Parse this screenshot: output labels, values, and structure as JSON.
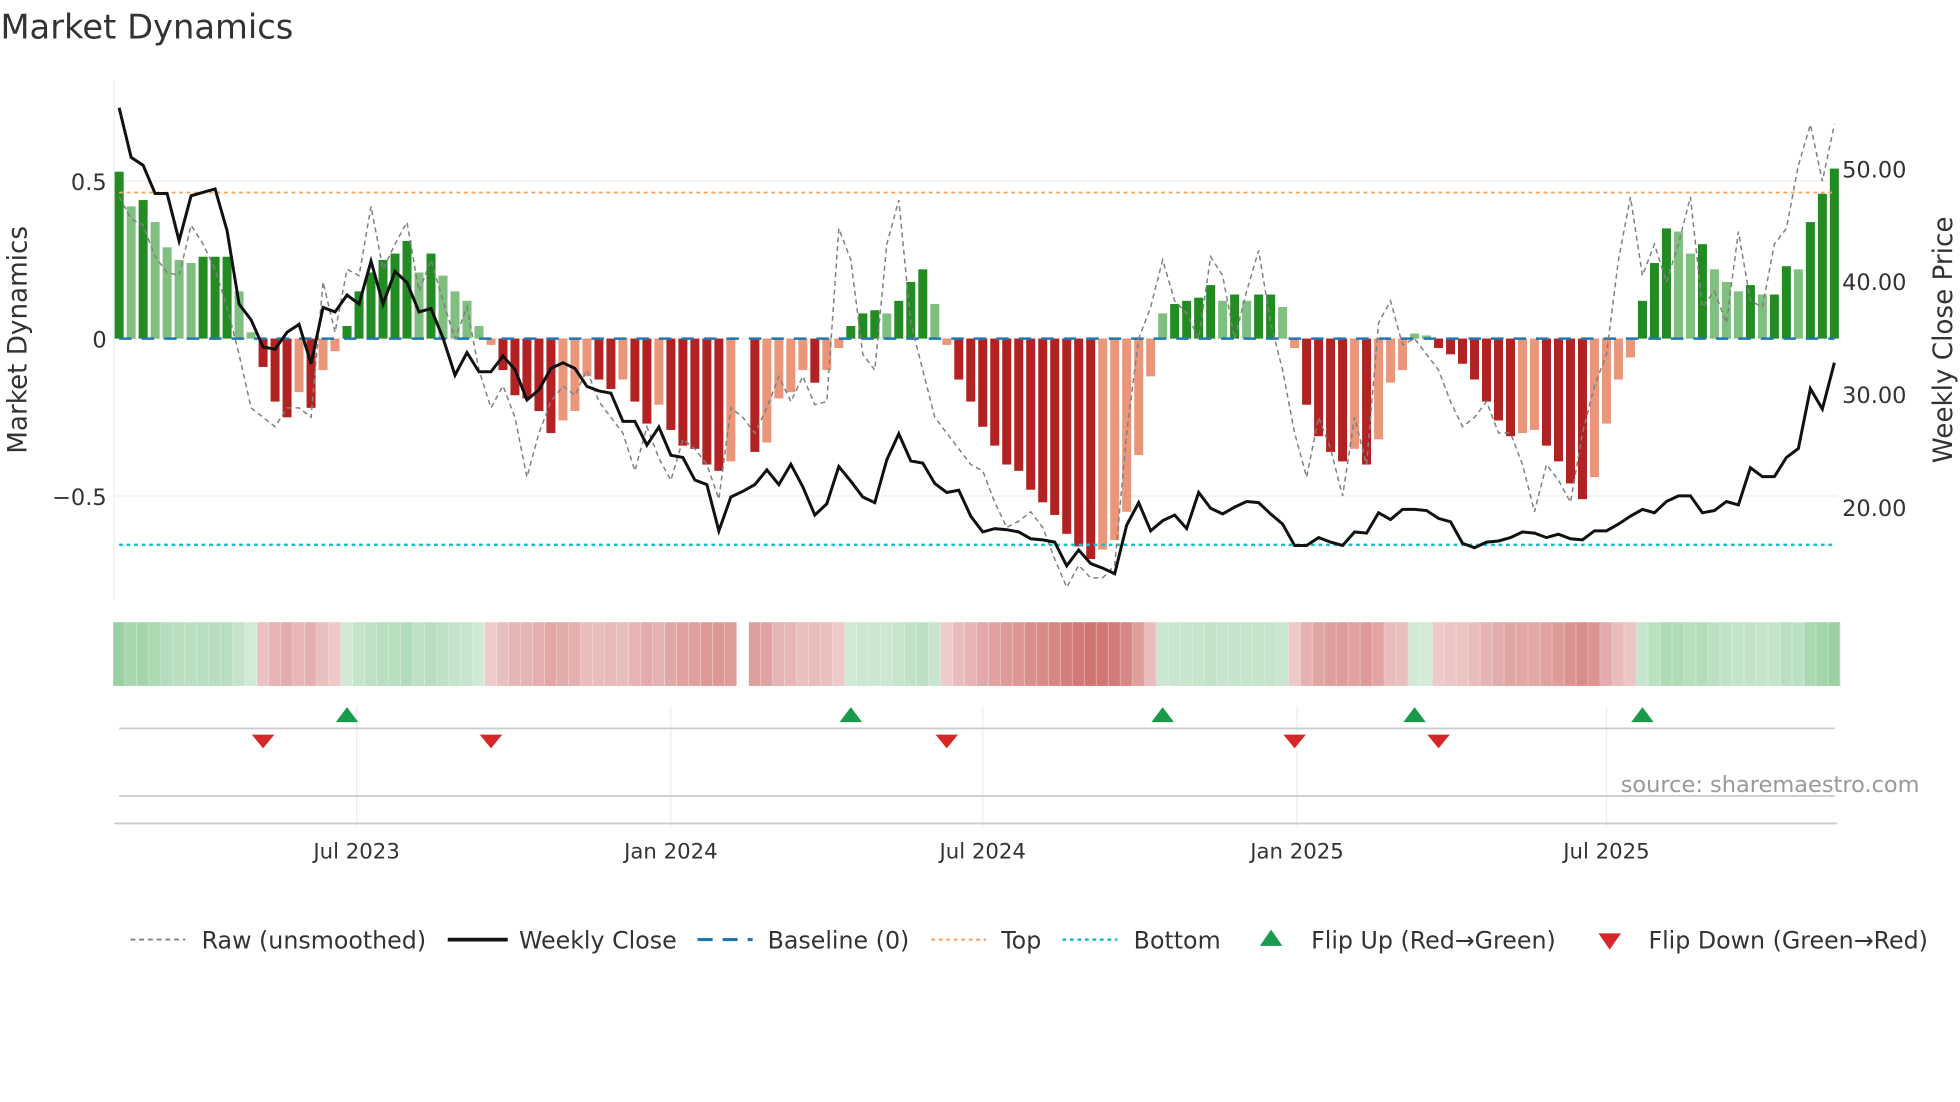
{
  "chart_data": {
    "type": "bar",
    "title": "Market Dynamics",
    "ylabel_left": "Market Dynamics",
    "ylabel_right": "Weekly Close Price",
    "ylim_left": [
      -0.83,
      0.78
    ],
    "ylim_right": [
      10.5,
      57
    ],
    "left_ticks": [
      {
        "v": 0.5,
        "label": "0.5"
      },
      {
        "v": 0,
        "label": "0"
      },
      {
        "v": -0.5,
        "label": "−0.5"
      }
    ],
    "right_ticks": [
      {
        "v": 50,
        "label": "50.00"
      },
      {
        "v": 40,
        "label": "40.00"
      },
      {
        "v": 30,
        "label": "30.00"
      },
      {
        "v": 20,
        "label": "20.00"
      }
    ],
    "x_ticks": [
      {
        "week": 19.8,
        "label": "Jul 2023"
      },
      {
        "week": 46.0,
        "label": "Jan 2024"
      },
      {
        "week": 72.0,
        "label": "Jul 2024"
      },
      {
        "week": 98.2,
        "label": "Jan 2025"
      },
      {
        "week": 124.0,
        "label": "Jul 2025"
      }
    ],
    "top_level": 0.464,
    "bottom_level": -0.655,
    "baseline": 0,
    "momentum": [
      0.53,
      0.42,
      0.44,
      0.37,
      0.29,
      0.25,
      0.24,
      0.26,
      0.26,
      0.26,
      0.15,
      0.02,
      -0.09,
      -0.2,
      -0.25,
      -0.17,
      -0.22,
      -0.1,
      -0.04,
      0.04,
      0.15,
      0.21,
      0.25,
      0.27,
      0.31,
      0.21,
      0.27,
      0.2,
      0.15,
      0.12,
      0.04,
      -0.02,
      -0.1,
      -0.18,
      -0.19,
      -0.23,
      -0.3,
      -0.26,
      -0.23,
      -0.12,
      -0.13,
      -0.16,
      -0.13,
      -0.2,
      -0.27,
      -0.21,
      -0.29,
      -0.34,
      -0.35,
      -0.4,
      -0.42,
      -0.39,
      null,
      -0.36,
      -0.33,
      -0.19,
      -0.17,
      -0.1,
      -0.14,
      -0.1,
      -0.03,
      0.04,
      0.08,
      0.09,
      0.08,
      0.12,
      0.18,
      0.22,
      0.11,
      -0.02,
      -0.13,
      -0.2,
      -0.28,
      -0.34,
      -0.4,
      -0.42,
      -0.48,
      -0.52,
      -0.56,
      -0.62,
      -0.66,
      -0.7,
      -0.67,
      -0.64,
      -0.55,
      -0.37,
      -0.12,
      0.08,
      0.11,
      0.12,
      0.13,
      0.17,
      0.12,
      0.14,
      0.12,
      0.14,
      0.14,
      0.1,
      -0.03,
      -0.21,
      -0.31,
      -0.36,
      -0.39,
      -0.35,
      -0.4,
      -0.32,
      -0.14,
      -0.1,
      0.016,
      0.01,
      -0.03,
      -0.05,
      -0.08,
      -0.13,
      -0.2,
      -0.26,
      -0.31,
      -0.3,
      -0.29,
      -0.34,
      -0.39,
      -0.46,
      -0.51,
      -0.44,
      -0.27,
      -0.13,
      -0.06,
      0.12,
      0.24,
      0.35,
      0.34,
      0.27,
      0.3,
      0.22,
      0.18,
      0.15,
      0.17,
      0.14,
      0.14,
      0.23,
      0.22,
      0.37,
      0.46,
      0.54
    ],
    "raw": [
      0.45,
      0.38,
      0.36,
      0.26,
      0.21,
      0.2,
      0.36,
      0.3,
      0.22,
      0.1,
      -0.05,
      -0.22,
      -0.25,
      -0.28,
      -0.22,
      -0.22,
      -0.25,
      0.18,
      0.02,
      0.22,
      0.2,
      0.42,
      0.22,
      0.3,
      0.37,
      0.15,
      0.25,
      0.12,
      0.0,
      0.1,
      -0.1,
      -0.22,
      -0.15,
      -0.25,
      -0.44,
      -0.3,
      -0.2,
      -0.15,
      -0.18,
      -0.1,
      -0.2,
      -0.25,
      -0.3,
      -0.42,
      -0.28,
      -0.38,
      -0.45,
      -0.32,
      -0.35,
      -0.4,
      -0.51,
      -0.22,
      -0.25,
      -0.3,
      -0.22,
      -0.12,
      -0.2,
      -0.12,
      -0.21,
      -0.2,
      0.35,
      0.25,
      -0.05,
      -0.1,
      0.3,
      0.44,
      0.05,
      -0.1,
      -0.25,
      -0.3,
      -0.35,
      -0.4,
      -0.42,
      -0.52,
      -0.6,
      -0.58,
      -0.55,
      -0.6,
      -0.7,
      -0.79,
      -0.72,
      -0.76,
      -0.76,
      -0.72,
      -0.3,
      0.0,
      0.1,
      0.25,
      0.12,
      0.08,
      0.0,
      0.26,
      0.2,
      0.0,
      0.15,
      0.28,
      0.05,
      -0.1,
      -0.3,
      -0.44,
      -0.25,
      -0.35,
      -0.5,
      -0.25,
      -0.4,
      0.05,
      0.12,
      -0.02,
      0.0,
      -0.05,
      -0.1,
      -0.2,
      -0.28,
      -0.25,
      -0.2,
      -0.3,
      -0.3,
      -0.4,
      -0.55,
      -0.4,
      -0.45,
      -0.52,
      -0.3,
      -0.15,
      -0.05,
      0.25,
      0.45,
      0.2,
      0.3,
      0.18,
      0.3,
      0.45,
      0.1,
      0.15,
      0.05,
      0.34,
      0.12,
      0.1,
      0.3,
      0.35,
      0.55,
      0.68,
      0.5,
      0.68
    ],
    "close": [
      55.4,
      51,
      50.3,
      47.8,
      47.8,
      43.6,
      47.6,
      47.9,
      48.2,
      44.5,
      38,
      36.6,
      34.2,
      34,
      35.5,
      36.2,
      32.7,
      37.7,
      37.3,
      38.8,
      38,
      41.8,
      38,
      40.9,
      39.9,
      37.3,
      37.6,
      35,
      31.7,
      33.7,
      32,
      32,
      33.4,
      32.2,
      29.5,
      30.4,
      32.3,
      32.8,
      32.3,
      30.7,
      30.3,
      30.1,
      27.6,
      27.6,
      25.5,
      27.1,
      24.6,
      24.4,
      22.4,
      22,
      17.9,
      20.9,
      21.4,
      22,
      23.3,
      22,
      23.8,
      21.8,
      19.3,
      20.3,
      23.6,
      22.3,
      20.9,
      20.4,
      24.2,
      26.5,
      24.1,
      23.9,
      22.1,
      21.3,
      21.5,
      19.2,
      17.8,
      18.1,
      18,
      17.8,
      17.2,
      17.1,
      16.9,
      14.8,
      16.2,
      15,
      14.6,
      14.1,
      18.4,
      20.4,
      17.9,
      18.8,
      19.3,
      18.1,
      21.3,
      19.9,
      19.4,
      20,
      20.5,
      20.4,
      19.4,
      18.5,
      16.6,
      16.6,
      17.3,
      16.9,
      16.6,
      17.8,
      17.7,
      19.5,
      18.9,
      19.8,
      19.8,
      19.7,
      19,
      18.7,
      16.8,
      16.4,
      16.9,
      17,
      17.3,
      17.8,
      17.7,
      17.3,
      17.6,
      17.2,
      17.1,
      17.9,
      17.9,
      18.5,
      19.2,
      19.8,
      19.5,
      20.5,
      21,
      21,
      19.5,
      19.7,
      20.5,
      20.2,
      23.5,
      22.7,
      22.7,
      24.4,
      25.2,
      30.5,
      28.7,
      32.8
    ],
    "flip_up_weeks": [
      19,
      61,
      87,
      108,
      127
    ],
    "flip_down_weeks": [
      12,
      31,
      69,
      98,
      110
    ],
    "legend": [
      "Raw (unsmoothed)",
      "Weekly Close",
      "Baseline (0)",
      "Top",
      "Bottom",
      "Flip Up (Red→Green)",
      "Flip Down (Green→Red)"
    ],
    "legend_placement": "bottom",
    "source": "source: sharemaestro.com",
    "colors": {
      "green_dark": "#228b22",
      "green_light": "#7fbf7f",
      "red_dark": "#b22222",
      "red_light": "#e9967a",
      "baseline": "#1f77b4",
      "top": "#f4a460",
      "bottom": "#17becf",
      "flip_up": "#1a9a4a",
      "flip_down": "#d62728",
      "close": "#111111",
      "raw": "#808080"
    }
  }
}
